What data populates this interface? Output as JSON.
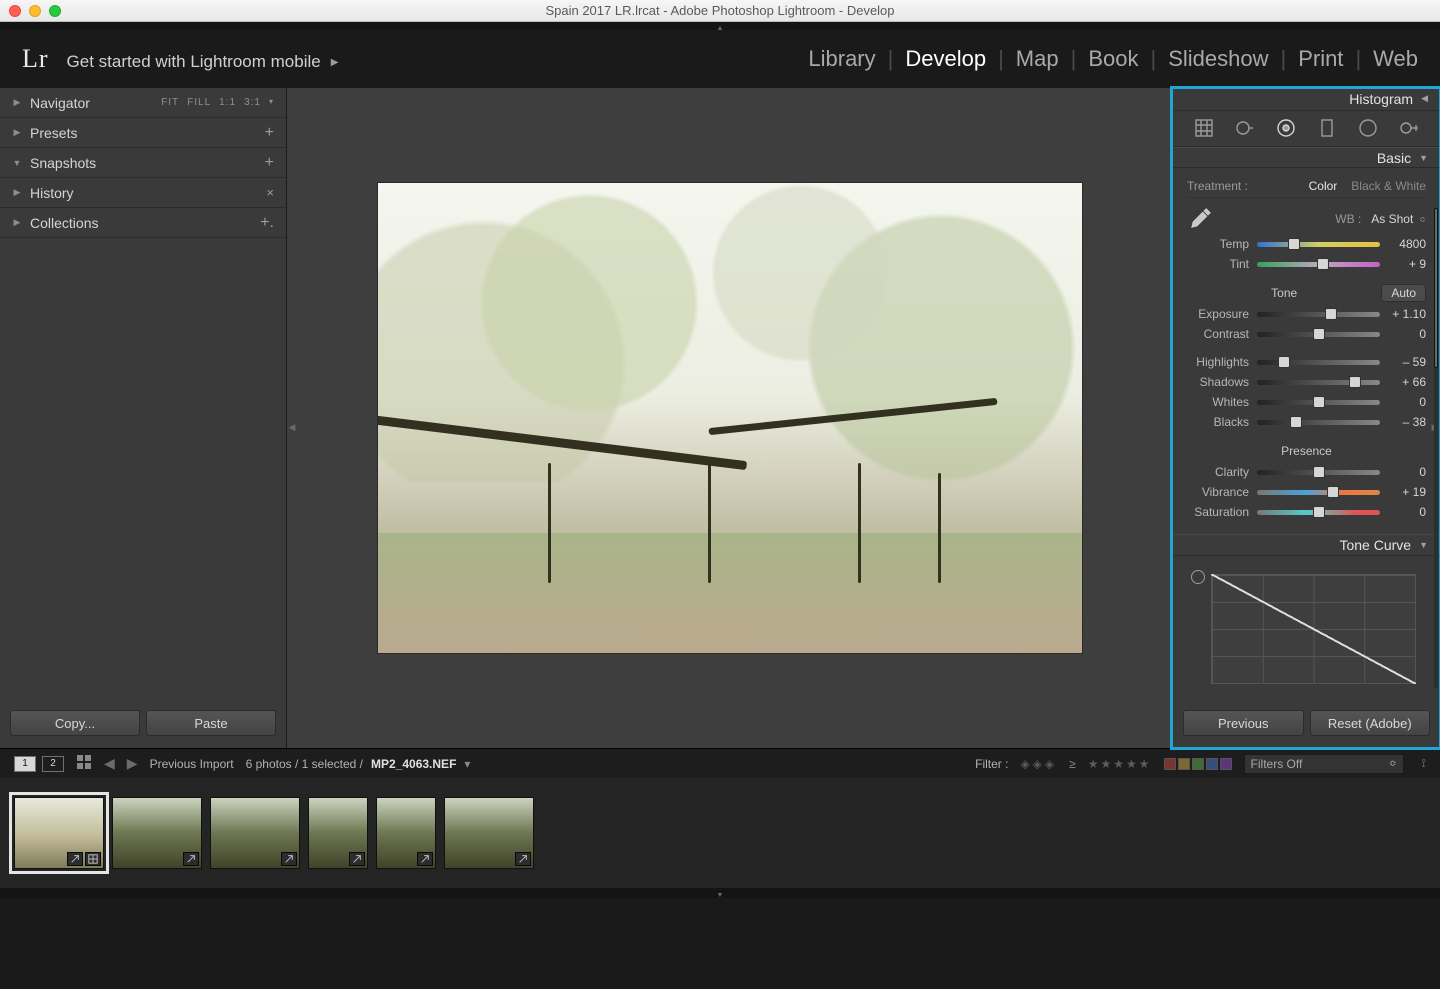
{
  "window": {
    "title": "Spain 2017 LR.lrcat - Adobe Photoshop Lightroom - Develop"
  },
  "identity": {
    "logo": "Lr",
    "getStarted": "Get started with Lightroom mobile"
  },
  "modules": {
    "items": [
      "Library",
      "Develop",
      "Map",
      "Book",
      "Slideshow",
      "Print",
      "Web"
    ],
    "active": "Develop"
  },
  "leftPanels": {
    "navigator": {
      "label": "Navigator",
      "zoom": [
        "FIT",
        "FILL",
        "1:1",
        "3:1"
      ]
    },
    "presets": {
      "label": "Presets"
    },
    "snapshots": {
      "label": "Snapshots"
    },
    "history": {
      "label": "History"
    },
    "collections": {
      "label": "Collections"
    },
    "copy": "Copy...",
    "paste": "Paste"
  },
  "right": {
    "histogram": "Histogram",
    "basic": {
      "title": "Basic",
      "treatmentLabel": "Treatment :",
      "treatColor": "Color",
      "treatBW": "Black & White",
      "wbLabel": "WB :",
      "wbValue": "As Shot",
      "temp": {
        "label": "Temp",
        "value": "4800",
        "pos": 30
      },
      "tint": {
        "label": "Tint",
        "value": "+ 9",
        "pos": 54
      },
      "toneTitle": "Tone",
      "auto": "Auto",
      "exposure": {
        "label": "Exposure",
        "value": "+ 1.10",
        "pos": 60
      },
      "contrast": {
        "label": "Contrast",
        "value": "0",
        "pos": 50
      },
      "highlights": {
        "label": "Highlights",
        "value": "– 59",
        "pos": 22
      },
      "shadows": {
        "label": "Shadows",
        "value": "+ 66",
        "pos": 80
      },
      "whites": {
        "label": "Whites",
        "value": "0",
        "pos": 50
      },
      "blacks": {
        "label": "Blacks",
        "value": "– 38",
        "pos": 32
      },
      "presenceTitle": "Presence",
      "clarity": {
        "label": "Clarity",
        "value": "0",
        "pos": 50
      },
      "vibrance": {
        "label": "Vibrance",
        "value": "+ 19",
        "pos": 62
      },
      "saturation": {
        "label": "Saturation",
        "value": "0",
        "pos": 50
      }
    },
    "toneCurve": "Tone Curve",
    "previous": "Previous",
    "reset": "Reset (Adobe)"
  },
  "infobar": {
    "monitors": [
      "1",
      "2"
    ],
    "source": "Previous Import",
    "count": "6 photos / 1 selected /",
    "file": "MP2_4063.NEF",
    "filterLabel": "Filter :",
    "ge": "≥",
    "filtersOff": "Filters Off"
  },
  "filmstrip": {
    "count": 6,
    "selected": 0
  },
  "colors": {
    "highlight": "#1ea7d6"
  }
}
